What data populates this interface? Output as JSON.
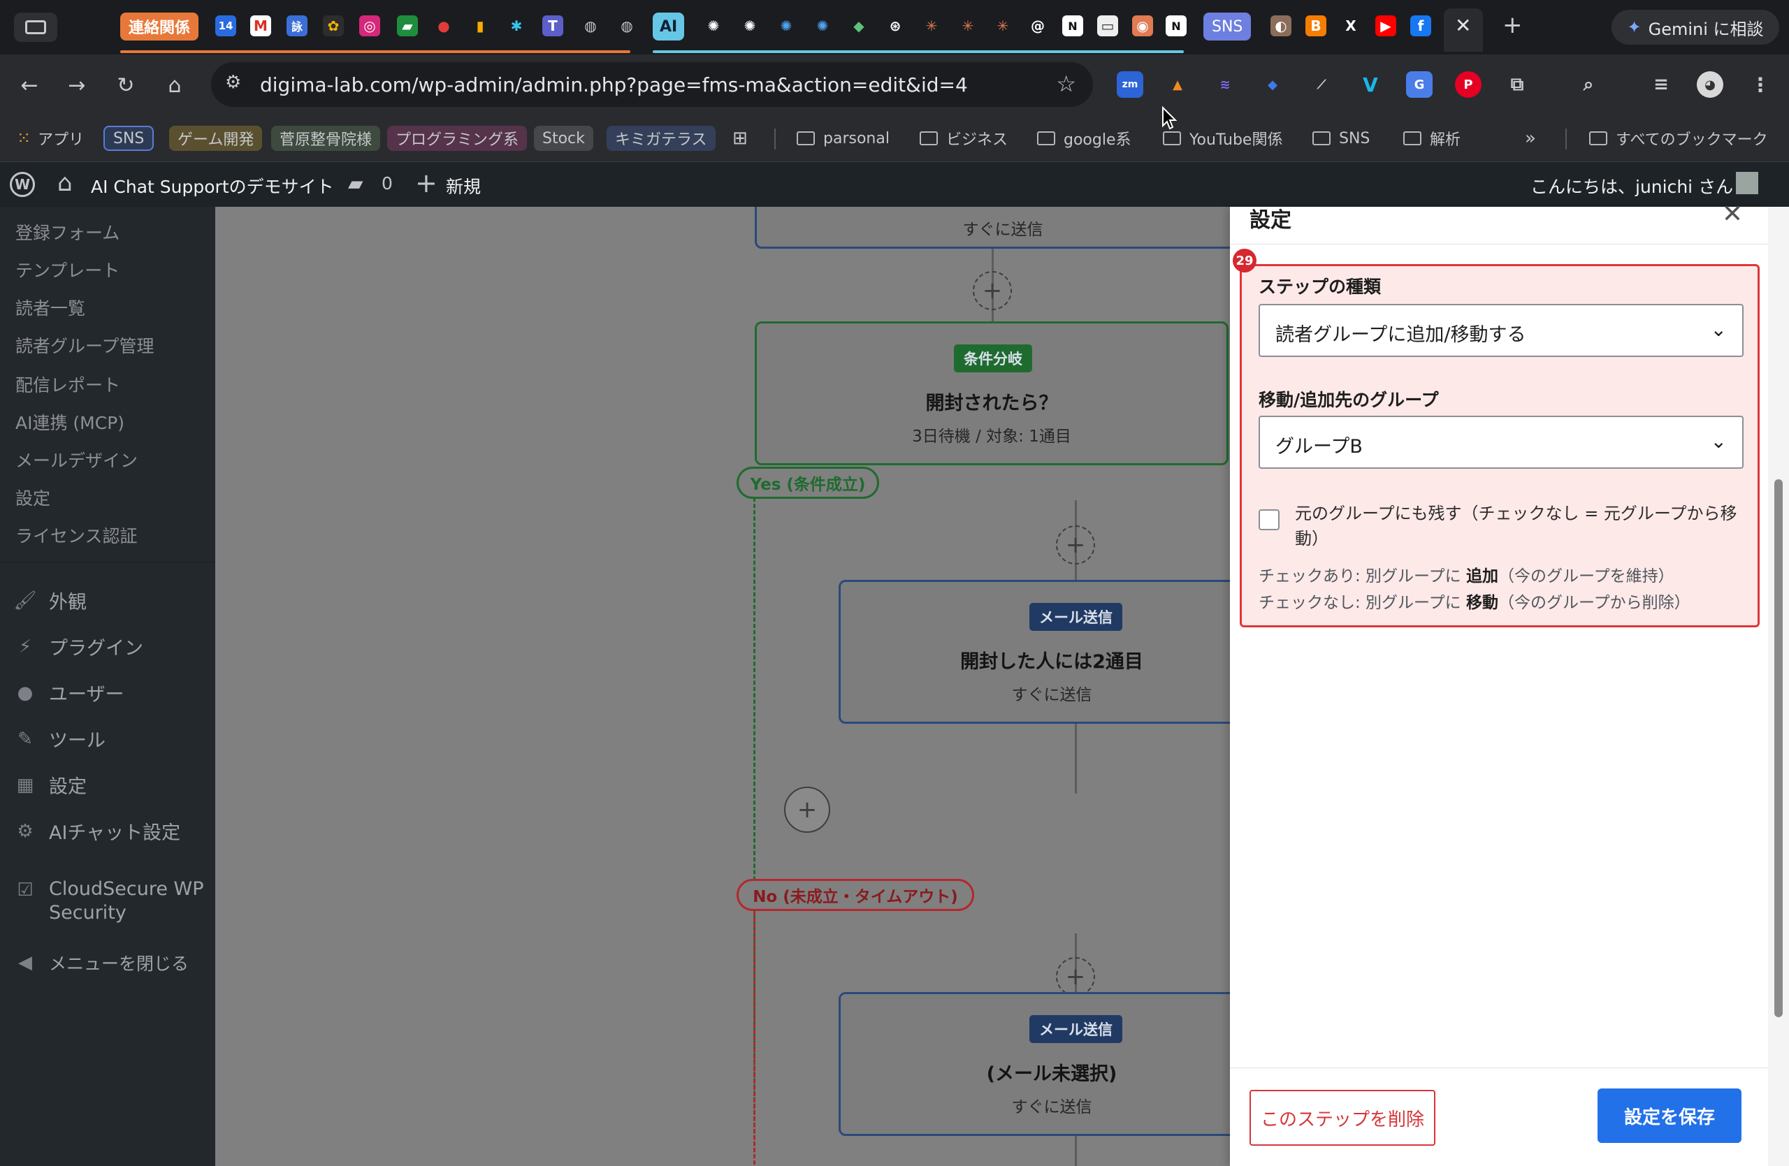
{
  "browser": {
    "tab_strip": {
      "group_label": "連絡関係",
      "calendar_day": "14",
      "sns_group": "SNS",
      "ai_tab": "AI",
      "gemini_button": "Gemini に相談"
    },
    "url": "digima-lab.com/wp-admin/admin.php?page=fms-ma&action=edit&id=4",
    "extensions": [
      "zm"
    ],
    "bookmarks": {
      "apps": "アプリ",
      "tags": [
        "SNS",
        "ゲーム開発",
        "菅原整骨院様",
        "プログラミング系",
        "Stock",
        "キミガテラス"
      ],
      "folders": [
        "parsonal",
        "ビジネス",
        "google系",
        "YouTube関係",
        "SNS",
        "解析"
      ],
      "more": "»",
      "all_bookmarks": "すべてのブックマーク"
    }
  },
  "adminbar": {
    "site_name": "AI Chat Supportのデモサイト",
    "comments_count": "0",
    "new_label": "新規",
    "greeting": "こんにちは、junichi さん"
  },
  "sidebar": {
    "submenu": [
      "登録フォーム",
      "テンプレート",
      "読者一覧",
      "読者グループ管理",
      "配信レポート",
      "AI連携 (MCP)",
      "メールデザイン",
      "設定",
      "ライセンス認証"
    ],
    "menu": [
      "外観",
      "プラグイン",
      "ユーザー",
      "ツール",
      "設定",
      "AIチャット設定"
    ],
    "security": [
      "CloudSecure WP",
      "Security"
    ],
    "collapse": "メニューを閉じる"
  },
  "canvas": {
    "top_card_sub": "すぐに送信",
    "condition": {
      "badge": "条件分岐",
      "title": "開封されたら？",
      "sub": "3日待機 / 対象: 1通目"
    },
    "yes_label": "Yes (条件成立)",
    "no_label": "No (未成立・タイムアウト)",
    "mail1": {
      "badge": "メール送信",
      "title": "開封した人には2通目",
      "sub": "すぐに送信"
    },
    "mail2": {
      "badge": "メール送信",
      "title": "(メール未選択)",
      "sub": "すぐに送信"
    },
    "plus": "+"
  },
  "panel": {
    "title": "設定",
    "close": "✕",
    "annotation_number": "29",
    "step_type_label": "ステップの種類",
    "step_type_value": "読者グループに追加/移動する",
    "target_group_label": "移動/追加先のグループ",
    "target_group_value": "グループB",
    "keep_checkbox_label": "元のグループにも残す（チェックなし = 元グループから移動）",
    "hint_checked_prefix": "チェックあり: 別グループに",
    "hint_checked_bold": "追加",
    "hint_checked_suffix": "（今のグループを維持）",
    "hint_unchecked_prefix": "チェックなし: 別グループに",
    "hint_unchecked_bold": "移動",
    "hint_unchecked_suffix": "（今のグループから削除）",
    "delete_button": "このステップを削除",
    "save_button": "設定を保存"
  }
}
